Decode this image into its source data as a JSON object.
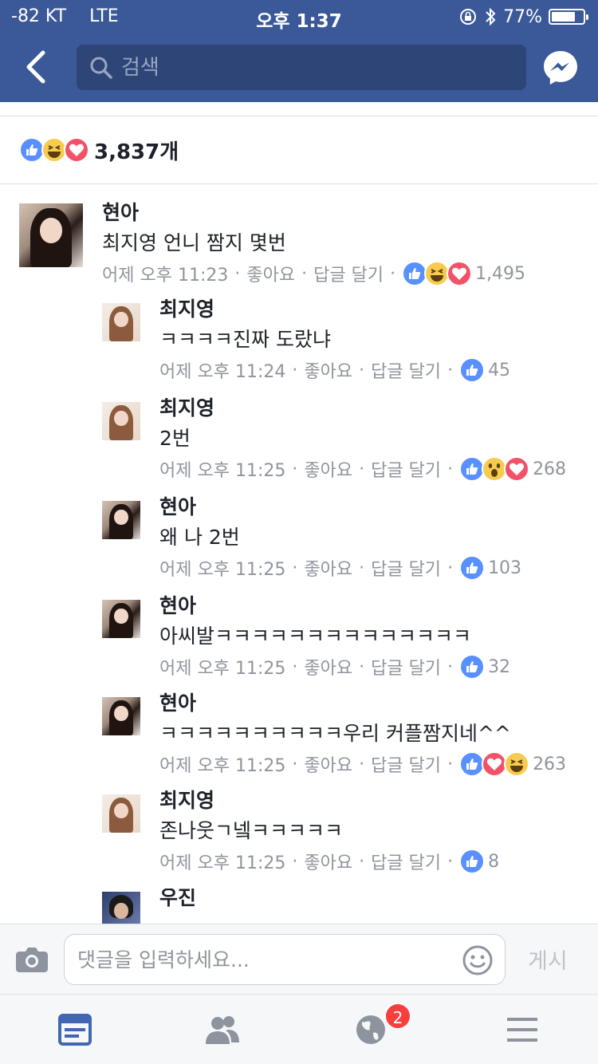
{
  "status_bar": {
    "carrier": "-82 KT",
    "network": "LTE",
    "time": "오후 1:37",
    "battery_text": "77%",
    "battery_level": 0.77
  },
  "header": {
    "search_placeholder": "검색"
  },
  "reactions": {
    "count": "3,837개",
    "icons": [
      "like",
      "haha",
      "love"
    ]
  },
  "comments": [
    {
      "name": "현아",
      "text": "최지영 언니 짬지 몇번",
      "time": "어제 오후 11:23",
      "like": "좋아요",
      "reply": "답글 달기",
      "reactions": [
        "like",
        "haha",
        "love"
      ],
      "count": "1,495",
      "level": 0
    },
    {
      "name": "최지영",
      "text": "ㅋㅋㅋㅋ진짜 도랐냐",
      "time": "어제 오후 11:24",
      "like": "좋아요",
      "reply": "답글 달기",
      "reactions": [
        "like"
      ],
      "count": "45",
      "level": 1
    },
    {
      "name": "최지영",
      "text": "2번",
      "time": "어제 오후 11:25",
      "like": "좋아요",
      "reply": "답글 달기",
      "reactions": [
        "like",
        "wow",
        "love"
      ],
      "count": "268",
      "level": 1
    },
    {
      "name": "현아",
      "text": "왜 나 2번",
      "time": "어제 오후 11:25",
      "like": "좋아요",
      "reply": "답글 달기",
      "reactions": [
        "like"
      ],
      "count": "103",
      "level": 1
    },
    {
      "name": "현아",
      "text": "아씨발ㅋㅋㅋㅋㅋㅋㅋㅋㅋㅋㅋㅋㅋㅋ",
      "time": "어제 오후 11:25",
      "like": "좋아요",
      "reply": "답글 달기",
      "reactions": [
        "like"
      ],
      "count": "32",
      "level": 1
    },
    {
      "name": "현아",
      "text": "ㅋㅋㅋㅋㅋㅋㅋㅋㅋㅋ우리 커플짬지네^^",
      "time": "어제 오후 11:25",
      "like": "좋아요",
      "reply": "답글 달기",
      "reactions": [
        "like",
        "love",
        "haha"
      ],
      "count": "263",
      "level": 1
    },
    {
      "name": "최지영",
      "text": "존나웃ㄱ넼ㅋㅋㅋㅋㅋ",
      "time": "어제 오후 11:25",
      "like": "좋아요",
      "reply": "답글 달기",
      "reactions": [
        "like"
      ],
      "count": "8",
      "level": 1
    },
    {
      "name": "우진",
      "text": "",
      "time": "",
      "like": "",
      "reply": "",
      "reactions": [],
      "count": "",
      "level": 1
    }
  ],
  "composer": {
    "placeholder": "댓글을 입력하세요...",
    "post_label": "게시"
  },
  "tabbar": {
    "notification_badge": "2"
  },
  "colors": {
    "brand": "#3b5998",
    "like": "#5890ff",
    "love": "#f25268",
    "haha": "#f7cb4d",
    "badge": "#fa3e3e"
  }
}
